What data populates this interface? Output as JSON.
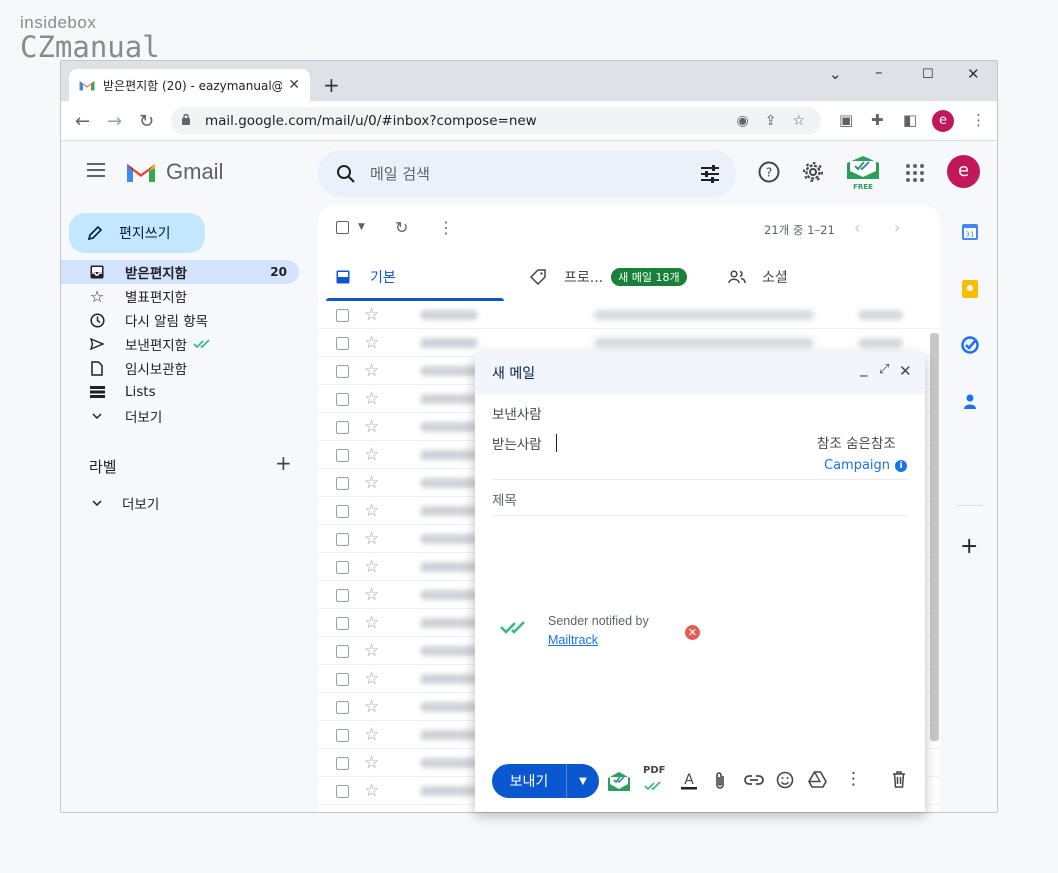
{
  "watermark": {
    "line1": "insidebox",
    "line2": "CZmanual"
  },
  "browser": {
    "tab_title": "받은편지함 (20) - eazymanual@",
    "url": "mail.google.com/mail/u/0/#inbox?compose=new",
    "profile_initial": "e"
  },
  "gmail": {
    "brand": "Gmail",
    "search_placeholder": "메일 검색",
    "mailtrack_free": "FREE",
    "avatar_initial": "e",
    "compose_label": "편지쓰기",
    "nav": [
      {
        "label": "받은편지함",
        "count": "20"
      },
      {
        "label": "별표편지함"
      },
      {
        "label": "다시 알림 항목"
      },
      {
        "label": "보낸편지함"
      },
      {
        "label": "임시보관함"
      },
      {
        "label": "Lists"
      },
      {
        "label": "더보기"
      }
    ],
    "labels_heading": "라벨",
    "labels_more": "더보기",
    "page_count": "21개 중 1–21",
    "tabs": [
      {
        "label": "기본"
      },
      {
        "label": "프로...",
        "badge": "새 메일 18개"
      },
      {
        "label": "소셜"
      }
    ]
  },
  "compose": {
    "title": "새 메일",
    "from_label": "보낸사람",
    "to_label": "받는사람",
    "cc_bcc": "참조 숨은참조",
    "campaign": "Campaign",
    "subject_placeholder": "제목",
    "notice_line1": "Sender notified by",
    "notice_link": "Mailtrack",
    "send_label": "보내기",
    "pdf_label": "PDF"
  },
  "colors": {
    "accent_blue": "#0b57d0",
    "compose_btn": "#c2e7ff",
    "badge_green": "#188038",
    "avatar": "#c2185b"
  }
}
